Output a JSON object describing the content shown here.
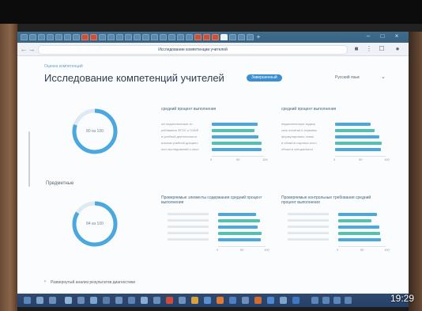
{
  "browser": {
    "url": "Исследование компетенции учителей",
    "nav": {
      "back": "←",
      "forward": "→"
    }
  },
  "page": {
    "breadcrumb": "Оценка компетенций",
    "title": "Исследование компетенций учителей",
    "badge": "Завершенный",
    "language": "Русский язык",
    "section_subject": "Предметные",
    "footer_link": "Развернутый анализ результатов диагностики"
  },
  "overall": {
    "ring_label": "80 из 100",
    "ring_fraction": 0.8,
    "panel_left": {
      "title": "средний процент выполнения",
      "rows": [
        {
          "label": "ых педагогических зн",
          "value": 88
        },
        {
          "label": "ребования ФГОС к ГИА/Е",
          "value": 82
        },
        {
          "label": "в учебной деятельности",
          "value": 90
        },
        {
          "label": "ализом учебной дисципл",
          "value": 95
        },
        {
          "label": "ных исследований и опыт",
          "value": 96
        }
      ],
      "ticks": [
        "0",
        "50",
        "100"
      ]
    },
    "panel_right": {
      "title": "средний процент выполнения",
      "rows": [
        {
          "label": "педагогическую задачу",
          "value": 70
        },
        {
          "label": "сать понятия и термины",
          "value": 78
        },
        {
          "label": "формулировать главн",
          "value": 88
        },
        {
          "label": "в области научных иссл",
          "value": 92
        },
        {
          "label": "области специалиста",
          "value": 90
        }
      ],
      "ticks": [
        "0",
        "50",
        "100"
      ]
    }
  },
  "subject": {
    "ring_label": "84 из 100",
    "ring_fraction": 0.84,
    "panel_left": {
      "title": "Проверяемые элементы содержания средний процент выполнения",
      "rows": [
        {
          "label": "",
          "value": 80
        },
        {
          "label": "",
          "value": 88
        },
        {
          "label": "",
          "value": 84
        },
        {
          "label": "",
          "value": 92
        },
        {
          "label": "",
          "value": 90
        }
      ],
      "ticks": [
        "0",
        "50",
        "100"
      ]
    },
    "panel_right": {
      "title": "Проверяемые контрольные требования средний процент выполнения",
      "rows": [
        {
          "label": "",
          "value": 82
        },
        {
          "label": "",
          "value": 70
        },
        {
          "label": "",
          "value": 86
        },
        {
          "label": "",
          "value": 88
        },
        {
          "label": "",
          "value": 90
        }
      ],
      "ticks": [
        "0",
        "50",
        "100"
      ]
    }
  },
  "colors": {
    "accent": "#3c8ed0",
    "ring": "#4aa8de",
    "bar_blue": "#4aa8de",
    "bar_teal": "#4fc2b2"
  },
  "overlay_time": "19:29"
}
